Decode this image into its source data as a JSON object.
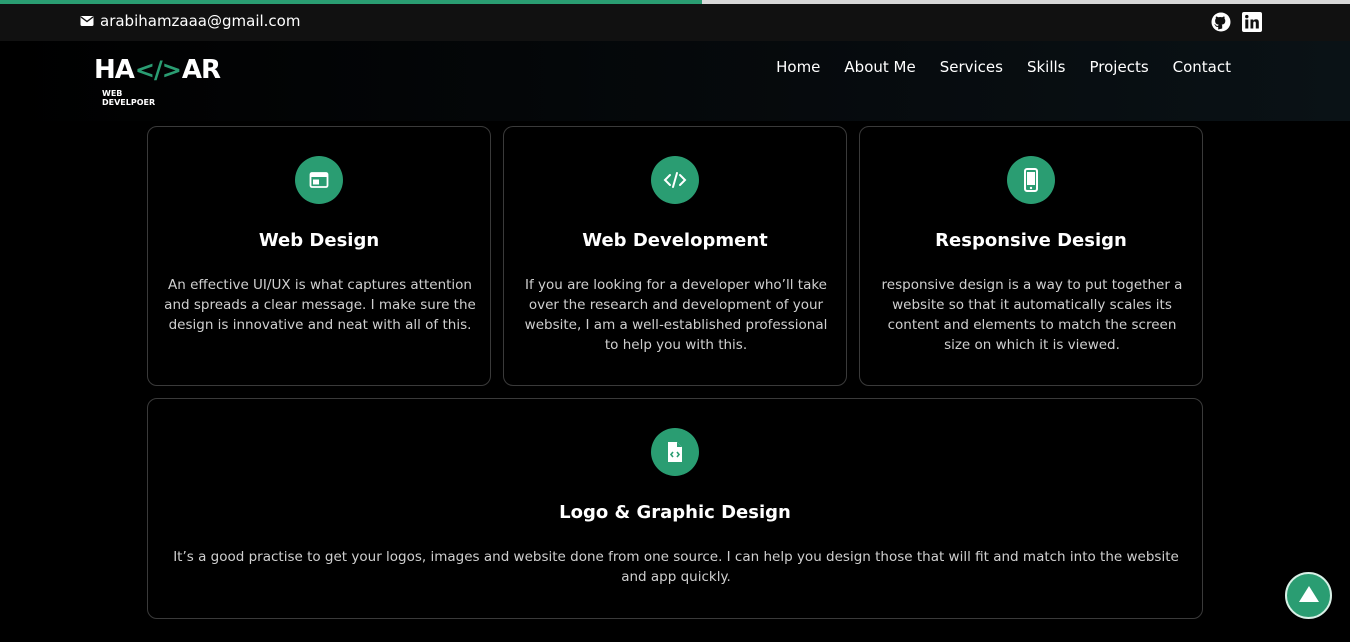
{
  "progress": {
    "percent": 52
  },
  "topbar": {
    "email": "arabihamzaaa@gmail.com",
    "social": [
      "github-icon",
      "linkedin-icon"
    ]
  },
  "logo": {
    "main_left": "HA",
    "main_code": "</>",
    "main_right": "AR",
    "subtitle": "WEB DEVELPOER"
  },
  "nav": {
    "items": [
      {
        "label": "Home"
      },
      {
        "label": "About Me"
      },
      {
        "label": "Services"
      },
      {
        "label": "Skills"
      },
      {
        "label": "Projects"
      },
      {
        "label": "Contact"
      }
    ]
  },
  "services": [
    {
      "icon": "browser-window-icon",
      "title": "Web Design",
      "description": "An effective UI/UX is what captures attention and spreads a clear message. I make sure the design is innovative and neat with all of this."
    },
    {
      "icon": "code-icon",
      "title": "Web Development",
      "description": "If you are looking for a developer who’ll take over the research and development of your website, I am a well-established professional to help you with this."
    },
    {
      "icon": "mobile-phone-icon",
      "title": "Responsive Design",
      "description": "responsive design is a way to put together a website so that it automatically scales its content and elements to match the screen size on which it is viewed."
    },
    {
      "icon": "file-code-icon",
      "title": "Logo & Graphic Design",
      "description": "It’s a good practise to get your logos, images and website done from one source. I can help you design those that will fit and match into the website and app quickly."
    }
  ],
  "colors": {
    "accent": "#2a9d72",
    "background": "#000000",
    "card_border": "#3a3a3a"
  }
}
